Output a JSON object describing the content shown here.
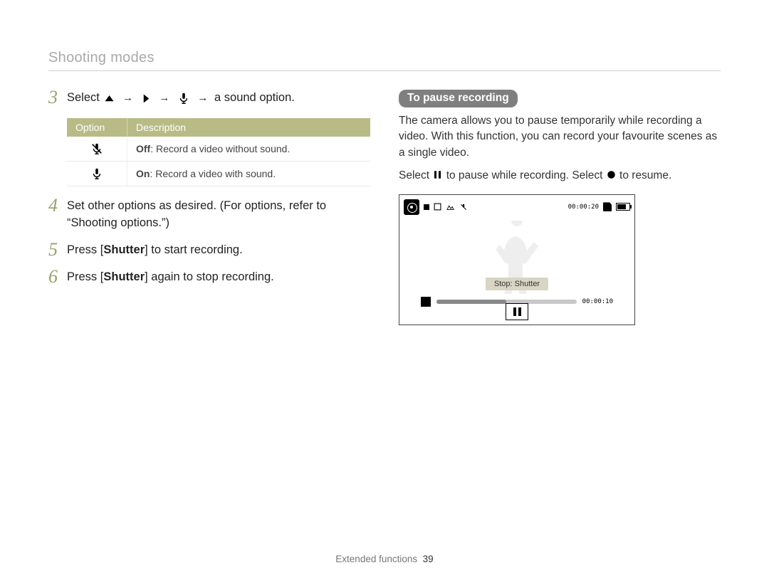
{
  "header": {
    "section_title": "Shooting modes"
  },
  "steps": {
    "s3": {
      "num": "3",
      "lead": "Select",
      "tail": "a sound option."
    },
    "s4": {
      "num": "4",
      "text": "Set other options as desired. (For options, refer to “Shooting options.”)"
    },
    "s5": {
      "num": "5",
      "pre": "Press [",
      "bold": "Shutter",
      "post": "] to start recording."
    },
    "s6": {
      "num": "6",
      "pre": "Press [",
      "bold": "Shutter",
      "post": "] again to stop recording."
    }
  },
  "table": {
    "head_option": "Option",
    "head_desc": "Description",
    "rows": [
      {
        "icon": "mic-off-icon",
        "bold": "Off",
        "text": ": Record a video without sound."
      },
      {
        "icon": "mic-on-icon",
        "bold": "On",
        "text": ": Record a video with sound."
      }
    ]
  },
  "right": {
    "pill": "To pause recording",
    "para1": "The camera allows you to pause temporarily while recording a video. With this function, you can record your favourite scenes as a single video.",
    "para2_pre": "Select ",
    "para2_mid": " to pause while recording. Select ",
    "para2_post": " to resume."
  },
  "screen": {
    "time_top": "00:00:20",
    "stop_label": "Stop: Shutter",
    "time_prog": "00:00:10"
  },
  "footer": {
    "label": "Extended functions",
    "page": "39"
  }
}
